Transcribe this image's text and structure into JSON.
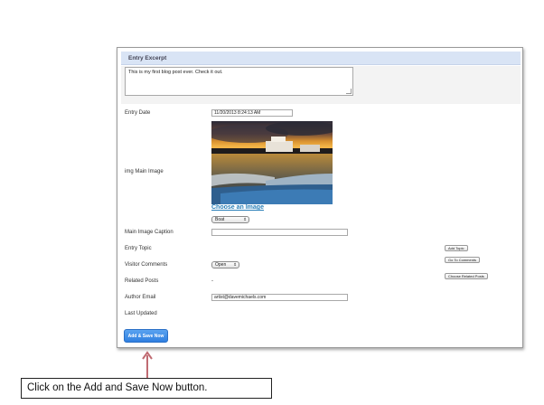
{
  "excerpt": {
    "header": "Entry Excerpt",
    "text": "This is my first blog post ever. Check it out."
  },
  "form": {
    "entry_date_label": "Entry Date",
    "entry_date_value": "11/20/2013 8:24:13 AM",
    "main_image_label": "img Main Image",
    "choose_image_link": "Choose an Image",
    "image_select_value": "Boat",
    "caption_label": "Main Image Caption",
    "caption_value": "",
    "topic_label": "Entry Topic",
    "add_topic_button": "Add Topic",
    "go_to_comments_button": "Go To Comments",
    "visitor_comments_label": "Visitor Comments",
    "visitor_comments_value": "Open",
    "related_posts_label": "Related Posts",
    "related_posts_value": "-",
    "choose_related_button": "Choose Related Posts",
    "author_email_label": "Author Email",
    "author_email_value": "artist@davemichaels.com",
    "last_updated_label": "Last Updated",
    "save_button": "Add & Save Now"
  },
  "callout": {
    "text": "Click on the Add and Save Now button."
  },
  "colors": {
    "accent": "#2f7fe0",
    "arrow": "#c06b72",
    "link": "#2a7fb8",
    "header_bg": "#d9e4f5"
  },
  "icons": {
    "select_arrows": "⇕"
  }
}
